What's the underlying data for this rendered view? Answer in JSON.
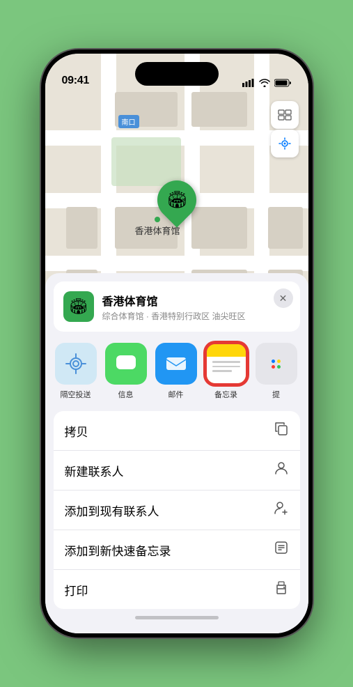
{
  "status_bar": {
    "time": "09:41",
    "signal": "●●●●",
    "wifi": "wifi",
    "battery": "battery"
  },
  "map": {
    "label_tag": "南口",
    "venue_name_marker": "香港体育馆"
  },
  "venue_card": {
    "icon_emoji": "🏟",
    "name": "香港体育馆",
    "subtitle": "综合体育馆 · 香港特别行政区 油尖旺区",
    "close_label": "×"
  },
  "share_items": [
    {
      "id": "airdrop",
      "label": "隔空投送",
      "type": "airdrop"
    },
    {
      "id": "message",
      "label": "信息",
      "type": "message"
    },
    {
      "id": "mail",
      "label": "邮件",
      "type": "mail"
    },
    {
      "id": "notes",
      "label": "备忘录",
      "type": "notes",
      "selected": true
    },
    {
      "id": "more",
      "label": "提",
      "type": "more"
    }
  ],
  "actions": [
    {
      "label": "拷贝",
      "icon": "copy"
    },
    {
      "label": "新建联系人",
      "icon": "person"
    },
    {
      "label": "添加到现有联系人",
      "icon": "person-add"
    },
    {
      "label": "添加到新快速备忘录",
      "icon": "note"
    },
    {
      "label": "打印",
      "icon": "print"
    }
  ]
}
